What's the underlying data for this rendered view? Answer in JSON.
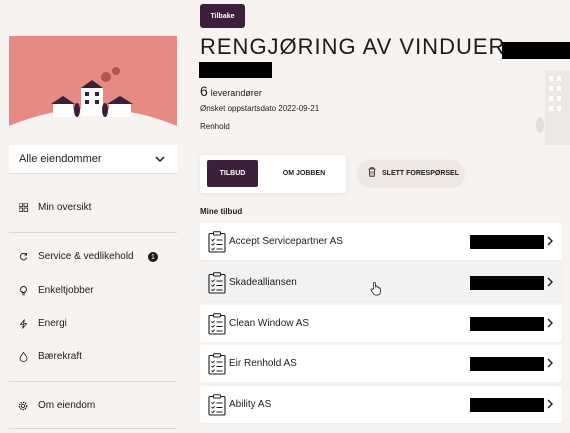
{
  "sidebar": {
    "property_select": "Alle eiendommer",
    "items": [
      {
        "label": "Min oversikt",
        "icon": "grid-icon"
      },
      {
        "label": "Service & vedlikehold",
        "icon": "refresh-icon",
        "badge": "1"
      },
      {
        "label": "Enkeltjobber",
        "icon": "lightbulb-icon"
      },
      {
        "label": "Energi",
        "icon": "lightning-icon"
      },
      {
        "label": "Bærekraft",
        "icon": "drop-icon"
      },
      {
        "label": "Om eiendom",
        "icon": "gear-icon"
      }
    ]
  },
  "header": {
    "back_label": "Tilbake",
    "title": "RENGJØRING AV VINDUER",
    "title_paren": "(",
    "supplier_count": "6",
    "supplier_label": "leverandører",
    "start_date": "Ønsket oppstartsdato 2022-09-21",
    "category": "Renhold"
  },
  "tabs": {
    "active": "TILBUD",
    "inactive": "OM JOBBEN"
  },
  "delete_label": "SLETT FORESPØRSEL",
  "offers_title": "Mine tilbud",
  "offers": [
    {
      "name": "Accept Servicepartner AS"
    },
    {
      "name": "Skadealliansen"
    },
    {
      "name": "Clean Window AS"
    },
    {
      "name": "Eir Renhold AS"
    },
    {
      "name": "Ability AS"
    }
  ],
  "colors": {
    "accent": "#3b1f3b",
    "hero": "#e88a84",
    "background": "#f7f3f1"
  }
}
